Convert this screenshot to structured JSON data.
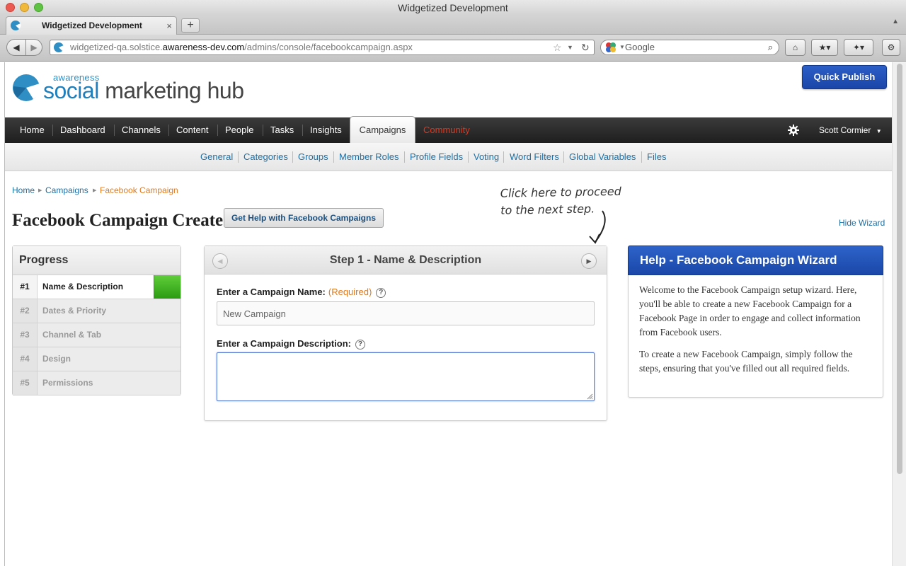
{
  "browser": {
    "window_title": "Widgetized Development",
    "tab_title": "Widgetized Development",
    "tab_close": "×",
    "new_tab": "+",
    "url_host_pre": "widgetized-qa.solstice.",
    "url_host_main": "awareness-dev.com",
    "url_path": "/admins/console/facebookcampaign.aspx",
    "search_placeholder": "Google"
  },
  "header": {
    "logo_small": "awareness",
    "logo_big_1": "social",
    "logo_big_2": " marketing hub",
    "quick_publish": "Quick Publish"
  },
  "main_nav": {
    "items": [
      "Home",
      "Dashboard",
      "Channels",
      "Content",
      "People",
      "Tasks",
      "Insights",
      "Campaigns",
      "Community"
    ],
    "active": "Campaigns",
    "user": "Scott Cormier"
  },
  "sub_nav": {
    "items": [
      "General",
      "Categories",
      "Groups",
      "Member Roles",
      "Profile Fields",
      "Voting",
      "Word Filters",
      "Global Variables",
      "Files"
    ]
  },
  "breadcrumb": {
    "items": [
      "Home",
      "Campaigns"
    ],
    "current": "Facebook Campaign"
  },
  "page": {
    "title": "Facebook Campaign Create",
    "help_button": "Get Help with Facebook Campaigns",
    "hide_wizard": "Hide Wizard",
    "annotation_line1": "Click here to proceed",
    "annotation_line2": "to the next step."
  },
  "progress": {
    "title": "Progress",
    "steps": [
      {
        "num": "#1",
        "label": "Name & Description",
        "state": "active"
      },
      {
        "num": "#2",
        "label": "Dates & Priority",
        "state": "pending"
      },
      {
        "num": "#3",
        "label": "Channel & Tab",
        "state": "pending"
      },
      {
        "num": "#4",
        "label": "Design",
        "state": "pending"
      },
      {
        "num": "#5",
        "label": "Permissions",
        "state": "pending"
      }
    ]
  },
  "step": {
    "title": "Step 1 - Name & Description",
    "name_label": "Enter a Campaign Name:",
    "required_label": "(Required)",
    "help_glyph": "?",
    "name_value": "New Campaign",
    "desc_label": "Enter a Campaign Description:",
    "desc_value": ""
  },
  "help_panel": {
    "title": "Help - Facebook Campaign Wizard",
    "para1": "Welcome to the Facebook Campaign setup wizard. Here, you'll be able to create a new Facebook Campaign for a Facebook Page in order to engage and collect information from Facebook users.",
    "para2": "To create a new Facebook Campaign, simply follow the steps, ensuring that you've filled out all required fields."
  },
  "colors": {
    "brand_blue": "#1d47a9",
    "link_blue": "#1e6fa3",
    "accent_orange": "#e07a1d",
    "community_red": "#e0361e",
    "progress_green": "#2d9b12"
  }
}
